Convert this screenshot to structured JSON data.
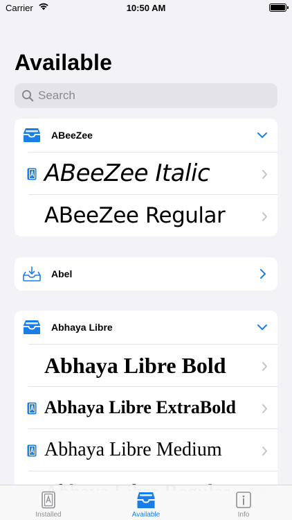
{
  "status_bar": {
    "carrier": "Carrier",
    "time": "10:50 AM"
  },
  "page": {
    "title": "Available"
  },
  "search": {
    "placeholder": "Search",
    "value": ""
  },
  "groups": [
    {
      "name": "ABeeZee",
      "expanded": true,
      "fonts": [
        {
          "name": "ABeeZee Italic",
          "installed": true
        },
        {
          "name": "ABeeZee Regular",
          "installed": false
        }
      ]
    },
    {
      "name": "Abel",
      "expanded": false,
      "fonts": []
    },
    {
      "name": "Abhaya Libre",
      "expanded": true,
      "fonts": [
        {
          "name": "Abhaya Libre Bold",
          "installed": false
        },
        {
          "name": "Abhaya Libre ExtraBold",
          "installed": true
        },
        {
          "name": "Abhaya Libre Medium",
          "installed": true
        },
        {
          "name": "Abhaya Libre Regular",
          "installed": false
        }
      ]
    }
  ],
  "tabs": [
    {
      "label": "Installed",
      "icon": "book-icon",
      "active": false
    },
    {
      "label": "Available",
      "icon": "tray-icon",
      "active": true
    },
    {
      "label": "Info",
      "icon": "info-icon",
      "active": false
    }
  ],
  "colors": {
    "accent": "#1a7ee8",
    "inactive": "#8e8e93",
    "background": "#f2f2f7"
  }
}
